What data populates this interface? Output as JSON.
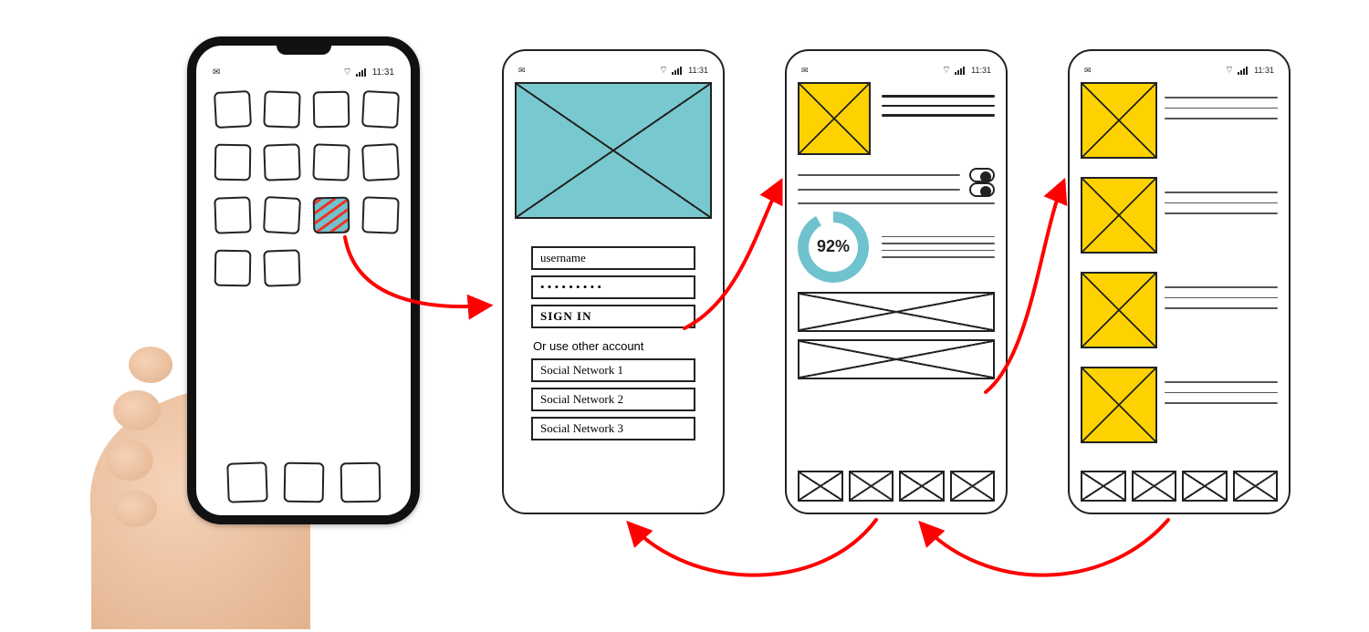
{
  "status": {
    "time": "11:31"
  },
  "login": {
    "username_label": "username",
    "password_masked": "• • • • • • • • •",
    "signin_label": "SIGN IN",
    "alt_caption": "Or use other account",
    "social": [
      "Social Network 1",
      "Social Network 2",
      "Social Network 3"
    ]
  },
  "dashboard": {
    "progress_percent": 92,
    "progress_label": "92%"
  },
  "flow": {
    "screens": [
      "home",
      "login",
      "dashboard",
      "list"
    ]
  }
}
